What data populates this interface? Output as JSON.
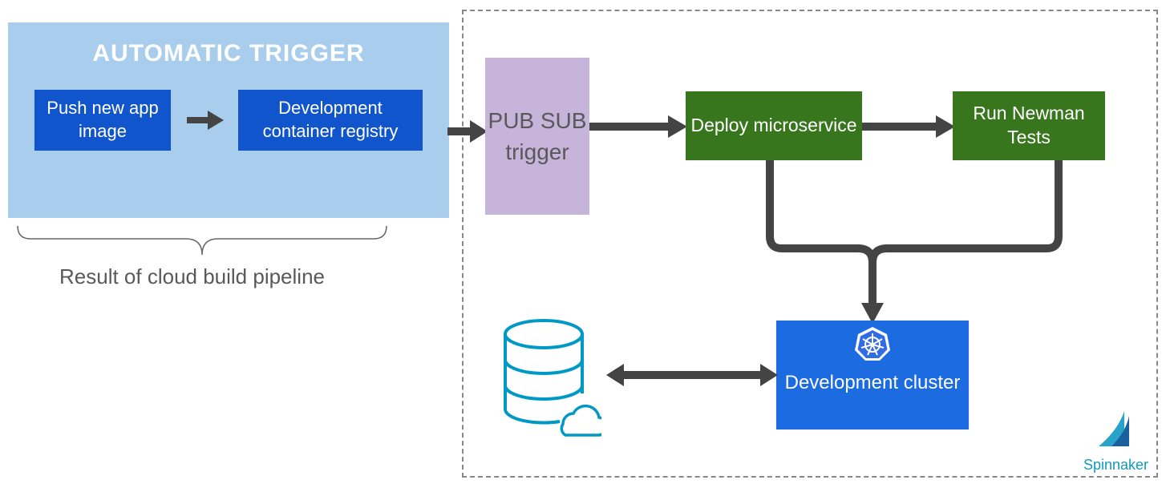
{
  "trigger": {
    "title": "AUTOMATIC TRIGGER",
    "push_label": "Push new app image",
    "registry_label": "Development container registry",
    "result_caption": "Result of cloud build pipeline"
  },
  "pipeline": {
    "pubsub_label": "PUB SUB trigger",
    "deploy_label": "Deploy microservice",
    "newman_label": "Run Newman Tests",
    "cluster_label": "Development cluster",
    "tool_label": "Spinnaker"
  },
  "icons": {
    "database": "database-cloud-icon",
    "kubernetes": "kubernetes-icon",
    "spinnaker_logo": "spinnaker-sail-icon"
  },
  "colors": {
    "light_blue_panel": "#a9cdec",
    "dark_blue_box": "#1155cc",
    "purple_box": "#c6b4da",
    "green_box": "#38761d",
    "cluster_blue": "#1c6be0",
    "arrow": "#444444",
    "db_stroke": "#0099c6"
  }
}
